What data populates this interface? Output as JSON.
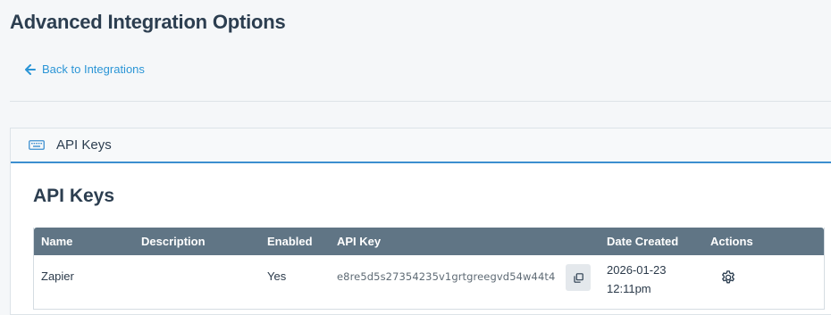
{
  "page": {
    "title": "Advanced Integration Options",
    "back_link": "Back to Integrations"
  },
  "panel": {
    "tab_label": "API Keys",
    "tab_icon": "keyboard-icon",
    "section_title": "API Keys"
  },
  "table": {
    "columns": [
      "Name",
      "Description",
      "Enabled",
      "API Key",
      "Date Created",
      "Actions"
    ],
    "rows": [
      {
        "name": "Zapier",
        "description": "",
        "enabled": "Yes",
        "api_key": "e8re5d5s27354235v1grtgreegvd54w44t4",
        "date_line1": "2026-01-23",
        "date_line2": "12:11pm"
      }
    ]
  },
  "colors": {
    "accent": "#2b95d6",
    "header_bg": "#607585",
    "tab_underline": "#3c8fd0"
  }
}
